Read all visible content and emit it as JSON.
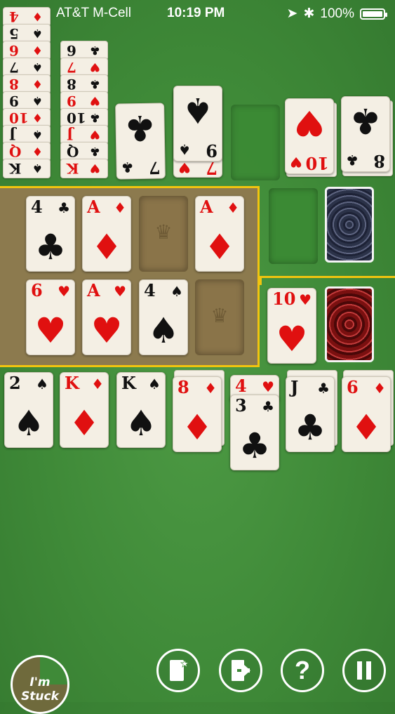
{
  "status_bar": {
    "carrier": "AT&T M-Cell",
    "time": "10:19 PM",
    "battery": "100%"
  },
  "top_left_stack_a": [
    {
      "rank": "K",
      "suit": "♠",
      "color": "black"
    },
    {
      "rank": "Q",
      "suit": "♦",
      "color": "red"
    },
    {
      "rank": "J",
      "suit": "♠",
      "color": "black"
    },
    {
      "rank": "10",
      "suit": "♦",
      "color": "red"
    },
    {
      "rank": "9",
      "suit": "♠",
      "color": "black"
    },
    {
      "rank": "8",
      "suit": "♦",
      "color": "red"
    },
    {
      "rank": "7",
      "suit": "♠",
      "color": "black"
    },
    {
      "rank": "6",
      "suit": "♦",
      "color": "red"
    },
    {
      "rank": "5",
      "suit": "♠",
      "color": "black"
    },
    {
      "rank": "4",
      "suit": "♦",
      "color": "red"
    }
  ],
  "top_left_stack_b": [
    {
      "rank": "K",
      "suit": "♥",
      "color": "red"
    },
    {
      "rank": "Q",
      "suit": "♣",
      "color": "black"
    },
    {
      "rank": "J",
      "suit": "♥",
      "color": "red"
    },
    {
      "rank": "10",
      "suit": "♣",
      "color": "black"
    },
    {
      "rank": "9",
      "suit": "♥",
      "color": "red"
    },
    {
      "rank": "8",
      "suit": "♣",
      "color": "black"
    },
    {
      "rank": "7",
      "suit": "♥",
      "color": "red"
    },
    {
      "rank": "6",
      "suit": "♣",
      "color": "black"
    }
  ],
  "top_row": {
    "seven_clubs": {
      "rank": "7",
      "suit": "♣",
      "color": "black"
    },
    "nine_spades": {
      "rank": "9",
      "suit": "♠",
      "color": "black",
      "under_rank": "7",
      "under_suit": "♥"
    },
    "ten_hearts": {
      "rank": "10",
      "suit": "♥",
      "color": "red"
    },
    "eight_clubs": {
      "rank": "8",
      "suit": "♣",
      "color": "black"
    }
  },
  "foundation_row1": [
    {
      "rank": "4",
      "suit": "♣",
      "color": "black"
    },
    {
      "rank": "A",
      "suit": "♦",
      "color": "red"
    },
    null,
    {
      "rank": "A",
      "suit": "♦",
      "color": "red"
    }
  ],
  "foundation_row2": [
    {
      "rank": "6",
      "suit": "♥",
      "color": "red"
    },
    {
      "rank": "A",
      "suit": "♥",
      "color": "red"
    },
    {
      "rank": "4",
      "suit": "♠",
      "color": "black"
    },
    null
  ],
  "waste_card": {
    "rank": "10",
    "suit": "♥",
    "color": "red"
  },
  "tableau": [
    {
      "rank": "2",
      "suit": "♠",
      "color": "black"
    },
    {
      "rank": "K",
      "suit": "♦",
      "color": "red"
    },
    {
      "rank": "K",
      "suit": "♠",
      "color": "black"
    },
    {
      "rank": "8",
      "suit": "♦",
      "color": "red"
    },
    {
      "rank": "3",
      "suit": "♣",
      "color": "black",
      "above_rank": "4",
      "above_suit": "♥"
    },
    {
      "rank": "J",
      "suit": "♣",
      "color": "black"
    },
    {
      "rank": "6",
      "suit": "♦",
      "color": "red"
    }
  ],
  "controls": {
    "stuck_label": "I'm Stuck",
    "new_game_icon": "card-star-icon",
    "exit_icon": "exit-door-icon",
    "help_label": "?",
    "pause_icon": "pause-icon"
  }
}
